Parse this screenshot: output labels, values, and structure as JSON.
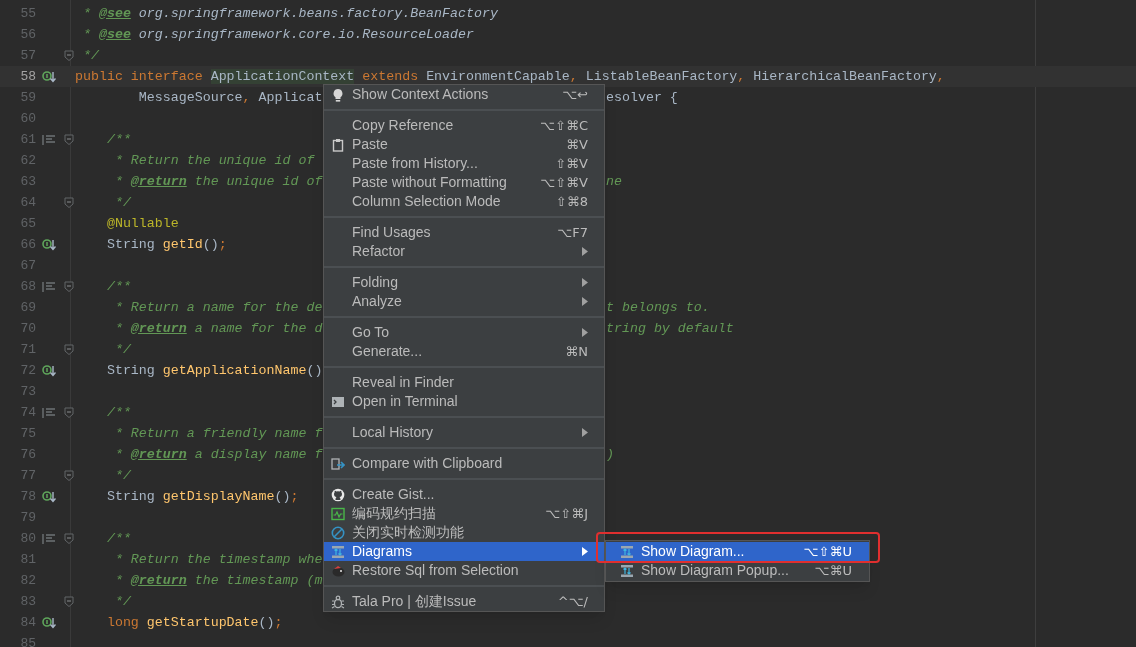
{
  "editor": {
    "lines": [
      {
        "number": "55",
        "current": false,
        "kind": "plain",
        "fold": false,
        "left": [
          {
            "text": " * ",
            "kind": "comment"
          },
          {
            "text": "@see",
            "kind": "doctag"
          },
          {
            "text": " org.springframework.beans.factory.BeanFactory",
            "kind": "docref"
          }
        ]
      },
      {
        "number": "56",
        "current": false,
        "kind": "plain",
        "fold": false,
        "left": [
          {
            "text": " * ",
            "kind": "comment"
          },
          {
            "text": "@see",
            "kind": "doctag"
          },
          {
            "text": " org.springframework.core.io.ResourceLoader",
            "kind": "docref"
          }
        ]
      },
      {
        "number": "57",
        "current": false,
        "kind": "plain",
        "fold": true,
        "left": [
          {
            "text": " */",
            "kind": "comment"
          }
        ]
      },
      {
        "number": "58",
        "current": true,
        "kind": "implemented",
        "fold": false,
        "left": [
          {
            "text": "public interface ",
            "kind": "keyword"
          },
          {
            "text": "ApplicationContext",
            "kind": "identifier_highlight"
          },
          {
            "text": " extends ",
            "kind": "keyword"
          },
          {
            "text": "EnvironmentCapable",
            "kind": "plain"
          },
          {
            "text": ", ",
            "kind": "punct"
          },
          {
            "text": "ListableBeanFactory",
            "kind": "plain"
          },
          {
            "text": ", ",
            "kind": "punct"
          },
          {
            "text": "HierarchicalBeanFactory",
            "kind": "plain"
          },
          {
            "text": ",",
            "kind": "punct"
          }
        ]
      },
      {
        "number": "59",
        "current": false,
        "kind": "plain",
        "fold": false,
        "left": [
          {
            "text": "        MessageSource",
            "kind": "plain"
          },
          {
            "text": ", ",
            "kind": "punct"
          },
          {
            "text": "Applicat",
            "kind": "plain"
          }
        ],
        "right": [
          {
            "text": "esolver {",
            "kind": "plain"
          }
        ]
      },
      {
        "number": "60",
        "current": false,
        "kind": "plain",
        "fold": false
      },
      {
        "number": "61",
        "current": false,
        "kind": "doc",
        "fold": true,
        "left": [
          {
            "text": "    /**",
            "kind": "comment"
          }
        ]
      },
      {
        "number": "62",
        "current": false,
        "kind": "plain",
        "fold": false,
        "left": [
          {
            "text": "     * Return the unique id of",
            "kind": "comment"
          }
        ]
      },
      {
        "number": "63",
        "current": false,
        "kind": "plain",
        "fold": false,
        "left": [
          {
            "text": "     * ",
            "kind": "comment"
          },
          {
            "text": "@return",
            "kind": "doctag"
          },
          {
            "text": " the unique id of",
            "kind": "comment"
          }
        ],
        "right": [
          {
            "text": "ne",
            "kind": "comment"
          }
        ]
      },
      {
        "number": "64",
        "current": false,
        "kind": "plain",
        "fold": true,
        "left": [
          {
            "text": "     */",
            "kind": "comment"
          }
        ]
      },
      {
        "number": "65",
        "current": false,
        "kind": "plain",
        "fold": false,
        "left": [
          {
            "text": "    @Nullable",
            "kind": "annotation"
          }
        ]
      },
      {
        "number": "66",
        "current": false,
        "kind": "implemented",
        "fold": false,
        "left": [
          {
            "text": "    String ",
            "kind": "plain"
          },
          {
            "text": "getId",
            "kind": "method"
          },
          {
            "text": "()",
            "kind": "plain"
          },
          {
            "text": ";",
            "kind": "punct"
          }
        ]
      },
      {
        "number": "67",
        "current": false,
        "kind": "plain",
        "fold": false
      },
      {
        "number": "68",
        "current": false,
        "kind": "doc",
        "fold": true,
        "left": [
          {
            "text": "    /**",
            "kind": "comment"
          }
        ]
      },
      {
        "number": "69",
        "current": false,
        "kind": "plain",
        "fold": false,
        "left": [
          {
            "text": "     * Return a name for the de",
            "kind": "comment"
          }
        ],
        "right": [
          {
            "text": "t belongs to.",
            "kind": "comment"
          }
        ]
      },
      {
        "number": "70",
        "current": false,
        "kind": "plain",
        "fold": false,
        "left": [
          {
            "text": "     * ",
            "kind": "comment"
          },
          {
            "text": "@return",
            "kind": "doctag"
          },
          {
            "text": " a name for the d",
            "kind": "comment"
          }
        ],
        "right": [
          {
            "text": "tring by default",
            "kind": "comment"
          }
        ]
      },
      {
        "number": "71",
        "current": false,
        "kind": "plain",
        "fold": true,
        "left": [
          {
            "text": "     */",
            "kind": "comment"
          }
        ]
      },
      {
        "number": "72",
        "current": false,
        "kind": "implemented",
        "fold": false,
        "left": [
          {
            "text": "    String ",
            "kind": "plain"
          },
          {
            "text": "getApplicationName",
            "kind": "method"
          },
          {
            "text": "()",
            "kind": "plain"
          }
        ]
      },
      {
        "number": "73",
        "current": false,
        "kind": "plain",
        "fold": false
      },
      {
        "number": "74",
        "current": false,
        "kind": "doc",
        "fold": true,
        "left": [
          {
            "text": "    /**",
            "kind": "comment"
          }
        ]
      },
      {
        "number": "75",
        "current": false,
        "kind": "plain",
        "fold": false,
        "left": [
          {
            "text": "     * Return a friendly name f",
            "kind": "comment"
          }
        ]
      },
      {
        "number": "76",
        "current": false,
        "kind": "plain",
        "fold": false,
        "left": [
          {
            "text": "     * ",
            "kind": "comment"
          },
          {
            "text": "@return",
            "kind": "doctag"
          },
          {
            "text": " a display name f",
            "kind": "comment"
          }
        ],
        "right": [
          {
            "text": ")",
            "kind": "comment"
          }
        ]
      },
      {
        "number": "77",
        "current": false,
        "kind": "plain",
        "fold": true,
        "left": [
          {
            "text": "     */",
            "kind": "comment"
          }
        ]
      },
      {
        "number": "78",
        "current": false,
        "kind": "implemented",
        "fold": false,
        "left": [
          {
            "text": "    String ",
            "kind": "plain"
          },
          {
            "text": "getDisplayName",
            "kind": "method"
          },
          {
            "text": "()",
            "kind": "plain"
          },
          {
            "text": ";",
            "kind": "punct"
          }
        ]
      },
      {
        "number": "79",
        "current": false,
        "kind": "plain",
        "fold": false
      },
      {
        "number": "80",
        "current": false,
        "kind": "doc",
        "fold": true,
        "left": [
          {
            "text": "    /**",
            "kind": "comment"
          }
        ]
      },
      {
        "number": "81",
        "current": false,
        "kind": "plain",
        "fold": false,
        "left": [
          {
            "text": "     * Return the timestamp whe",
            "kind": "comment"
          }
        ]
      },
      {
        "number": "82",
        "current": false,
        "kind": "plain",
        "fold": false,
        "left": [
          {
            "text": "     * ",
            "kind": "comment"
          },
          {
            "text": "@return",
            "kind": "doctag"
          },
          {
            "text": " the timestamp (m",
            "kind": "comment"
          }
        ]
      },
      {
        "number": "83",
        "current": false,
        "kind": "plain",
        "fold": true,
        "left": [
          {
            "text": "     */",
            "kind": "comment"
          }
        ]
      },
      {
        "number": "84",
        "current": false,
        "kind": "implemented",
        "fold": false,
        "left": [
          {
            "text": "    long ",
            "kind": "keyword"
          },
          {
            "text": "getStartupDate",
            "kind": "method"
          },
          {
            "text": "()",
            "kind": "plain"
          },
          {
            "text": ";",
            "kind": "punct"
          }
        ]
      },
      {
        "number": "85",
        "current": false,
        "kind": "plain",
        "fold": false
      }
    ]
  },
  "context_menu": {
    "groups": [
      [
        {
          "label": "Show Context Actions",
          "shortcut": "⌥↩",
          "kind": "bulb",
          "submenu": false,
          "selected": false
        }
      ],
      [
        {
          "label": "Copy Reference",
          "shortcut": "⌥⇧⌘C",
          "kind": "plain",
          "submenu": false,
          "selected": false
        },
        {
          "label": "Paste",
          "shortcut": "⌘V",
          "kind": "clipboard",
          "submenu": false,
          "selected": false
        },
        {
          "label": "Paste from History...",
          "shortcut": "⇧⌘V",
          "kind": "plain",
          "submenu": false,
          "selected": false
        },
        {
          "label": "Paste without Formatting",
          "shortcut": "⌥⇧⌘V",
          "kind": "plain",
          "submenu": false,
          "selected": false
        },
        {
          "label": "Column Selection Mode",
          "shortcut": "⇧⌘8",
          "kind": "plain",
          "submenu": false,
          "selected": false
        }
      ],
      [
        {
          "label": "Find Usages",
          "shortcut": "⌥F7",
          "kind": "plain",
          "submenu": false,
          "selected": false
        },
        {
          "label": "Refactor",
          "kind": "plain",
          "submenu": true,
          "selected": false
        }
      ],
      [
        {
          "label": "Folding",
          "kind": "plain",
          "submenu": true,
          "selected": false
        },
        {
          "label": "Analyze",
          "kind": "plain",
          "submenu": true,
          "selected": false
        }
      ],
      [
        {
          "label": "Go To",
          "kind": "plain",
          "submenu": true,
          "selected": false
        },
        {
          "label": "Generate...",
          "shortcut": "⌘N",
          "kind": "plain",
          "submenu": false,
          "selected": false
        }
      ],
      [
        {
          "label": "Reveal in Finder",
          "kind": "plain",
          "submenu": false,
          "selected": false
        },
        {
          "label": "Open in Terminal",
          "kind": "terminal",
          "submenu": false,
          "selected": false
        }
      ],
      [
        {
          "label": "Local History",
          "kind": "plain",
          "submenu": true,
          "selected": false
        }
      ],
      [
        {
          "label": "Compare with Clipboard",
          "kind": "compare",
          "submenu": false,
          "selected": false
        }
      ],
      [
        {
          "label": "Create Gist...",
          "kind": "github",
          "submenu": false,
          "selected": false
        },
        {
          "label": "编码规约扫描",
          "shortcut": "⌥⇧⌘J",
          "kind": "scan",
          "submenu": false,
          "selected": false
        },
        {
          "label": "关闭实时检测功能",
          "kind": "forbid",
          "submenu": false,
          "selected": false
        },
        {
          "label": "Diagrams",
          "kind": "diagram",
          "submenu": true,
          "selected": true
        },
        {
          "label": "Restore Sql from Selection",
          "kind": "bird",
          "submenu": false,
          "selected": false
        }
      ],
      [
        {
          "label": "Tala Pro | 创建Issue",
          "shortcut": "^⌥/",
          "kind": "bug",
          "submenu": false,
          "selected": false
        }
      ]
    ]
  },
  "submenu": {
    "items": [
      {
        "label": "Show Diagram...",
        "shortcut": "⌥⇧⌘U",
        "kind": "diagram",
        "selected": true,
        "outlined": true
      },
      {
        "label": "Show Diagram Popup...",
        "shortcut": "⌥⌘U",
        "kind": "diagram",
        "selected": false,
        "outlined": false
      }
    ]
  }
}
